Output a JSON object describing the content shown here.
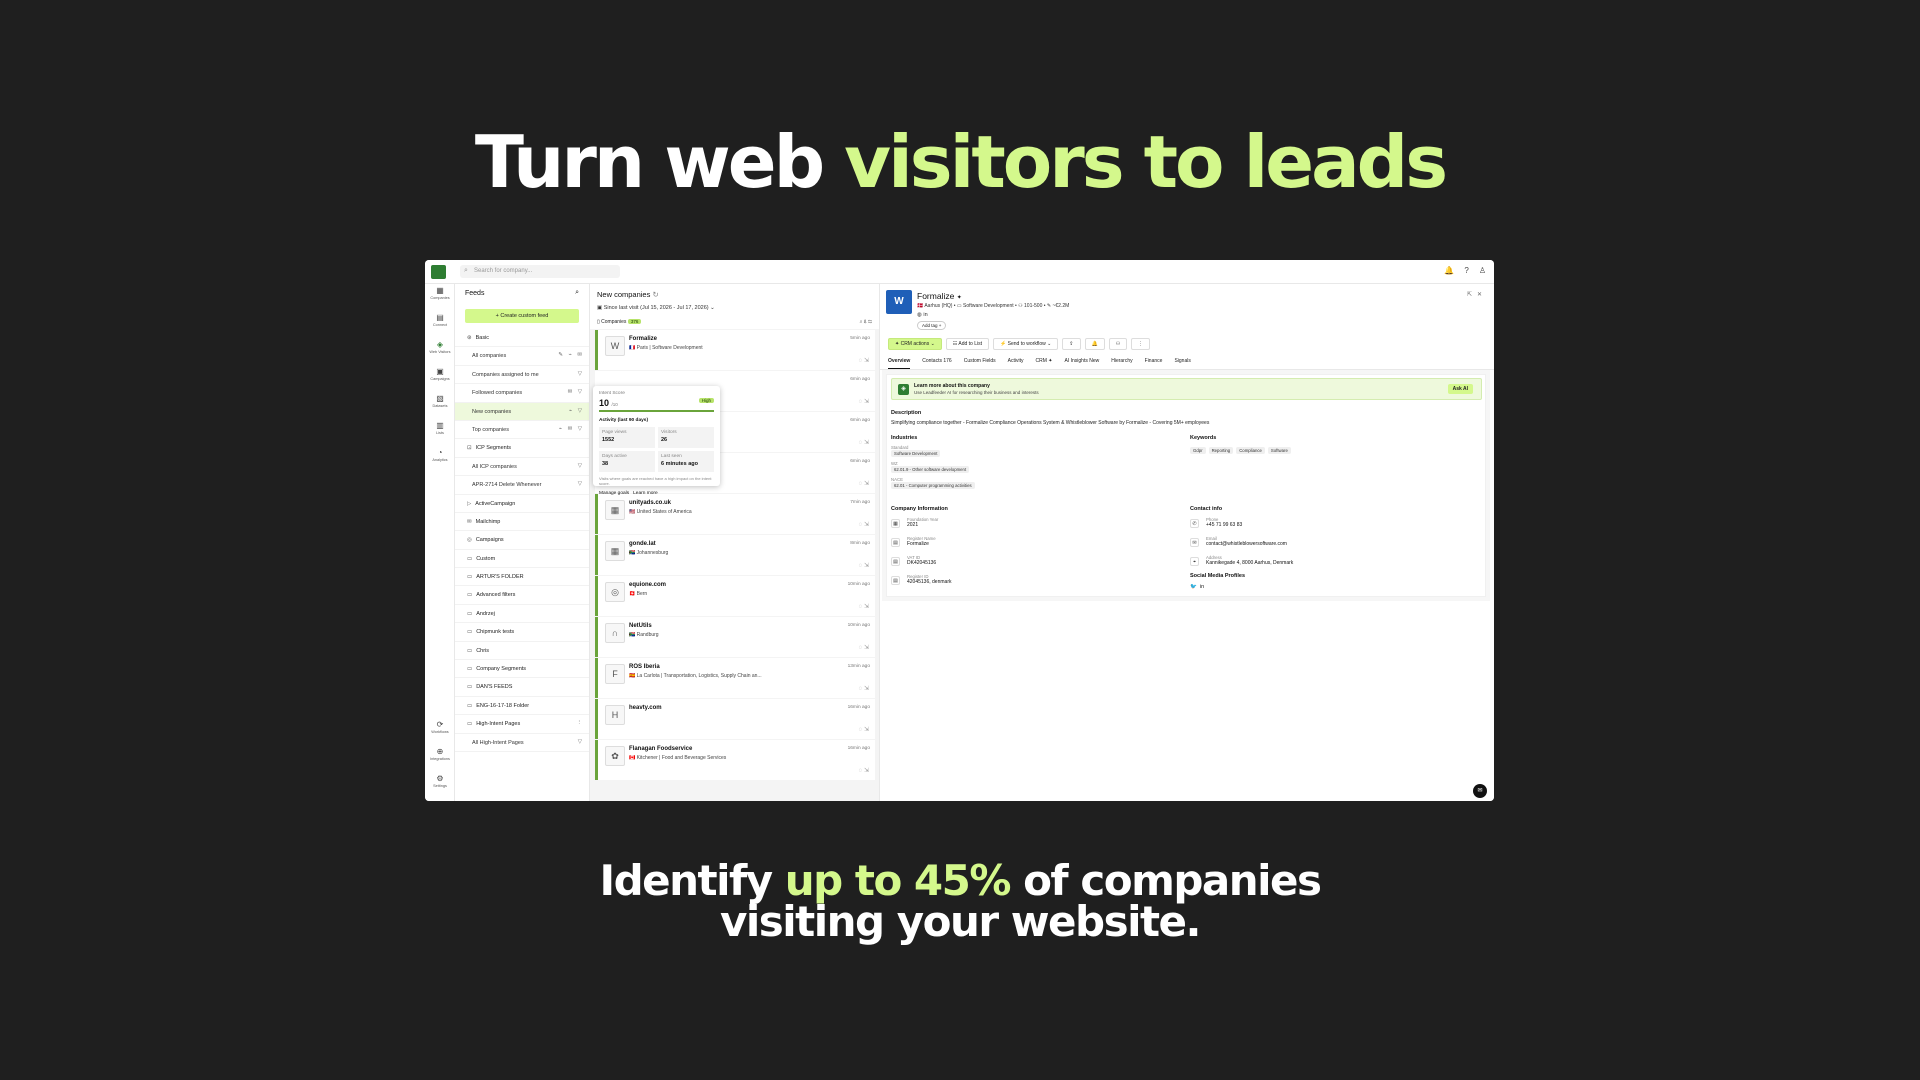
{
  "hero": {
    "title_a": "Turn web ",
    "title_b": "visitors to leads"
  },
  "subtitle": {
    "a": "Identify ",
    "b": "up to 45%",
    "c": " of companies",
    "d": "visiting your website."
  },
  "topbar": {
    "search_placeholder": "Search for company..."
  },
  "rail": [
    {
      "icon": "▦",
      "label": "Companies"
    },
    {
      "icon": "▤",
      "label": "Connect"
    },
    {
      "icon": "◈",
      "label": "Web Visitors"
    },
    {
      "icon": "▣",
      "label": "Campaigns"
    },
    {
      "icon": "▧",
      "label": "Datasets"
    },
    {
      "icon": "▥",
      "label": "Lists"
    },
    {
      "icon": "◔",
      "label": "Analytics"
    }
  ],
  "rail_bottom": [
    {
      "icon": "⟳",
      "label": "Workflows",
      "badge": "New"
    },
    {
      "icon": "⊕",
      "label": "Integrations"
    },
    {
      "icon": "⚙",
      "label": "Settings"
    }
  ],
  "feeds": {
    "title": "Feeds",
    "create": "+ Create custom feed",
    "items": [
      {
        "label": "Basic",
        "icon": "⊛",
        "sub": false,
        "sel": false,
        "icons": ""
      },
      {
        "label": "All companies",
        "icon": "",
        "sub": true,
        "sel": false,
        "icons": "✎ ⌁ ✉"
      },
      {
        "label": "Companies assigned to me",
        "icon": "",
        "sub": true,
        "sel": false,
        "icons": "▽"
      },
      {
        "label": "Followed companies",
        "icon": "",
        "sub": true,
        "sel": false,
        "icons": "✉ ▽"
      },
      {
        "label": "New companies",
        "icon": "",
        "sub": true,
        "sel": true,
        "icons": "⌁ ▽"
      },
      {
        "label": "Top companies",
        "icon": "",
        "sub": true,
        "sel": false,
        "icons": "⌁ ✉ ▽"
      },
      {
        "label": "ICP Segments",
        "icon": "⊡",
        "sub": false,
        "sel": false,
        "icons": ""
      },
      {
        "label": "All ICP companies",
        "icon": "",
        "sub": true,
        "sel": false,
        "icons": "▽"
      },
      {
        "label": "APR-2714 Delete Whenever",
        "icon": "",
        "sub": true,
        "sel": false,
        "icons": "▽"
      },
      {
        "label": "ActiveCampaign",
        "icon": "▷",
        "sub": false,
        "sel": false,
        "icons": ""
      },
      {
        "label": "Mailchimp",
        "icon": "✉",
        "sub": false,
        "sel": false,
        "icons": ""
      },
      {
        "label": "Campaigns",
        "icon": "◎",
        "sub": false,
        "sel": false,
        "icons": ""
      },
      {
        "label": "Custom",
        "icon": "▭",
        "sub": false,
        "sel": false,
        "icons": ""
      },
      {
        "label": "ARTUR'S FOLDER",
        "icon": "▭",
        "sub": false,
        "sel": false,
        "icons": ""
      },
      {
        "label": "Advanced filters",
        "icon": "▭",
        "sub": false,
        "sel": false,
        "icons": ""
      },
      {
        "label": "Andrzej",
        "icon": "▭",
        "sub": false,
        "sel": false,
        "icons": ""
      },
      {
        "label": "Chipmunk tests",
        "icon": "▭",
        "sub": false,
        "sel": false,
        "icons": ""
      },
      {
        "label": "Chris",
        "icon": "▭",
        "sub": false,
        "sel": false,
        "icons": ""
      },
      {
        "label": "Company Segments",
        "icon": "▭",
        "sub": false,
        "sel": false,
        "icons": ""
      },
      {
        "label": "DAN'S FEEDS",
        "icon": "▭",
        "sub": false,
        "sel": false,
        "icons": ""
      },
      {
        "label": "ENG-16-17-18 Folder",
        "icon": "▭",
        "sub": false,
        "sel": false,
        "icons": ""
      },
      {
        "label": "High-Intent Pages",
        "icon": "▭",
        "sub": false,
        "sel": false,
        "icons": "⋮"
      },
      {
        "label": "All High-Intent Pages",
        "icon": "",
        "sub": true,
        "sel": false,
        "icons": "▽"
      }
    ]
  },
  "list": {
    "title": "New companies",
    "range": "Since last visit (Jul 15, 2026 - Jul 17, 2026)",
    "tab": "Companies",
    "count": "376",
    "companies": [
      {
        "name": "Formalize",
        "flag": "🇫🇷",
        "loc": "Paris",
        "ind": "Software Development",
        "time": "5min ago",
        "logo": "W"
      },
      {
        "name": "",
        "flag": "",
        "loc": "",
        "ind": "",
        "time": "6min ago",
        "logo": ""
      },
      {
        "name": "",
        "flag": "",
        "loc": "",
        "ind": "",
        "time": "6min ago",
        "logo": ""
      },
      {
        "name": "",
        "flag": "",
        "loc": "",
        "ind": "",
        "time": "6min ago",
        "logo": ""
      },
      {
        "name": "unityads.co.uk",
        "flag": "🇺🇸",
        "loc": "United States of America",
        "ind": "",
        "time": "7min ago",
        "logo": "▦"
      },
      {
        "name": "gonde.lat",
        "flag": "🇿🇦",
        "loc": "Johannesburg",
        "ind": "",
        "time": "8min ago",
        "logo": "▦"
      },
      {
        "name": "equione.com",
        "flag": "🇨🇭",
        "loc": "Bern",
        "ind": "",
        "time": "10min ago",
        "logo": "◎"
      },
      {
        "name": "NetUtils",
        "flag": "🇿🇦",
        "loc": "Randburg",
        "ind": "",
        "time": "10min ago",
        "logo": "∩"
      },
      {
        "name": "ROS Iberia",
        "flag": "🇪🇸",
        "loc": "La Carlota",
        "ind": "Transportation, Logistics, Supply Chain an...",
        "time": "13min ago",
        "logo": "F"
      },
      {
        "name": "heavty.com",
        "flag": "",
        "loc": "",
        "ind": "",
        "time": "16min ago",
        "logo": "H"
      },
      {
        "name": "Flanagan Foodservice",
        "flag": "🇨🇦",
        "loc": "Kitchener",
        "ind": "Food and Beverage Services",
        "time": "16min ago",
        "logo": "✿"
      }
    ]
  },
  "popup": {
    "intent_label": "Intent Score",
    "intent_value": "10",
    "intent_max": "/10",
    "level": "High",
    "activity": "Activity (last 90 days)",
    "stats": [
      {
        "label": "Page views",
        "value": "1552"
      },
      {
        "label": "Visitors",
        "value": "26"
      },
      {
        "label": "Days active",
        "value": "38"
      },
      {
        "label": "Last seen",
        "value": "6 minutes ago"
      }
    ],
    "note": "Visits where goals are reached have a high impact on the intent score.",
    "manage": "Manage goals",
    "learn": "Learn more"
  },
  "detail": {
    "name": "Formalize",
    "meta": "🇩🇰 Aarhus (HQ)  •  ▭ Software Development  •  ⚇ 101-500  •  ✎ ~€2.2M",
    "add_tag": "Add tag +",
    "buttons": [
      "✦ CRM actions ⌄",
      "☷ Add to List",
      "⚡ Send to workflow ⌄",
      "⇪",
      "🔔",
      "⚇",
      "⋮"
    ],
    "tabs": [
      {
        "label": "Overview",
        "on": true
      },
      {
        "label": "Contacts 176",
        "on": false
      },
      {
        "label": "Custom Fields",
        "on": false
      },
      {
        "label": "Activity",
        "on": false
      },
      {
        "label": "CRM ✦",
        "on": false
      },
      {
        "label": "AI Insights New",
        "on": false
      },
      {
        "label": "Hierarchy",
        "on": false
      },
      {
        "label": "Finance",
        "on": false
      },
      {
        "label": "Signals",
        "on": false
      }
    ],
    "ai_title": "Learn more about this company",
    "ai_sub": "Use Leadfeeder AI for researching their business and interests",
    "ask_ai": "Ask AI",
    "desc_h": "Description",
    "desc": "Simplifying compliance together - Formalize Compliance Operations System & Whistleblower Software by Formalize - Covering 5M+ employees",
    "industries_h": "Industries",
    "std_l": "Standard",
    "std_v": "Software Development",
    "wz_l": "WZ",
    "wz_v": "62.01.9 - Other software development",
    "nace_l": "NACE",
    "nace_v": "62.01 - Computer programming activities",
    "keywords_h": "Keywords",
    "keywords": [
      "Gdpr",
      "Reporting",
      "Compliance",
      "Software"
    ],
    "company_h": "Company Information",
    "company": [
      {
        "icon": "▦",
        "label": "Foundation Year",
        "value": "2021"
      },
      {
        "icon": "▤",
        "label": "Register Name",
        "value": "Formalize"
      },
      {
        "icon": "▤",
        "label": "VAT ID",
        "value": "DK42045136"
      },
      {
        "icon": "▤",
        "label": "Register ID",
        "value": "42045136, denmark"
      }
    ],
    "contact_h": "Contact info",
    "contact": [
      {
        "icon": "✆",
        "label": "Phone",
        "value": "+45 71 99 63 83"
      },
      {
        "icon": "✉",
        "label": "Email",
        "value": "contact@whistleblowersoftware.com"
      },
      {
        "icon": "⌖",
        "label": "Address",
        "value": "Kannikegade 4, 8000 Aarhus, Denmark"
      }
    ],
    "social_h": "Social Media Profiles"
  }
}
